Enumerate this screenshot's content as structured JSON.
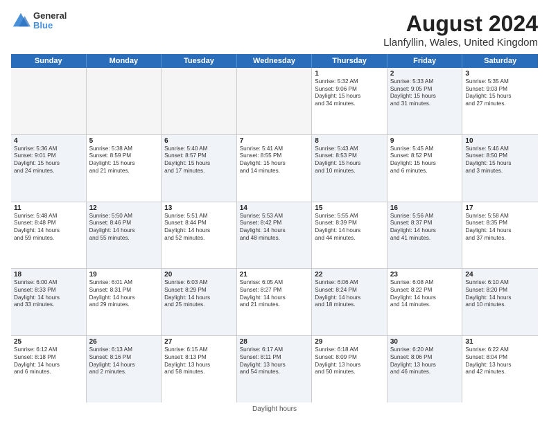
{
  "header": {
    "logo_line1": "General",
    "logo_line2": "Blue",
    "main_title": "August 2024",
    "subtitle": "Llanfyllin, Wales, United Kingdom"
  },
  "weekdays": [
    "Sunday",
    "Monday",
    "Tuesday",
    "Wednesday",
    "Thursday",
    "Friday",
    "Saturday"
  ],
  "footer": "Daylight hours",
  "rows": [
    [
      {
        "num": "",
        "lines": [],
        "shaded": false,
        "empty": true
      },
      {
        "num": "",
        "lines": [],
        "shaded": false,
        "empty": true
      },
      {
        "num": "",
        "lines": [],
        "shaded": false,
        "empty": true
      },
      {
        "num": "",
        "lines": [],
        "shaded": false,
        "empty": true
      },
      {
        "num": "1",
        "lines": [
          "Sunrise: 5:32 AM",
          "Sunset: 9:06 PM",
          "Daylight: 15 hours",
          "and 34 minutes."
        ],
        "shaded": false,
        "empty": false
      },
      {
        "num": "2",
        "lines": [
          "Sunrise: 5:33 AM",
          "Sunset: 9:05 PM",
          "Daylight: 15 hours",
          "and 31 minutes."
        ],
        "shaded": true,
        "empty": false
      },
      {
        "num": "3",
        "lines": [
          "Sunrise: 5:35 AM",
          "Sunset: 9:03 PM",
          "Daylight: 15 hours",
          "and 27 minutes."
        ],
        "shaded": false,
        "empty": false
      }
    ],
    [
      {
        "num": "4",
        "lines": [
          "Sunrise: 5:36 AM",
          "Sunset: 9:01 PM",
          "Daylight: 15 hours",
          "and 24 minutes."
        ],
        "shaded": true,
        "empty": false
      },
      {
        "num": "5",
        "lines": [
          "Sunrise: 5:38 AM",
          "Sunset: 8:59 PM",
          "Daylight: 15 hours",
          "and 21 minutes."
        ],
        "shaded": false,
        "empty": false
      },
      {
        "num": "6",
        "lines": [
          "Sunrise: 5:40 AM",
          "Sunset: 8:57 PM",
          "Daylight: 15 hours",
          "and 17 minutes."
        ],
        "shaded": true,
        "empty": false
      },
      {
        "num": "7",
        "lines": [
          "Sunrise: 5:41 AM",
          "Sunset: 8:55 PM",
          "Daylight: 15 hours",
          "and 14 minutes."
        ],
        "shaded": false,
        "empty": false
      },
      {
        "num": "8",
        "lines": [
          "Sunrise: 5:43 AM",
          "Sunset: 8:53 PM",
          "Daylight: 15 hours",
          "and 10 minutes."
        ],
        "shaded": true,
        "empty": false
      },
      {
        "num": "9",
        "lines": [
          "Sunrise: 5:45 AM",
          "Sunset: 8:52 PM",
          "Daylight: 15 hours",
          "and 6 minutes."
        ],
        "shaded": false,
        "empty": false
      },
      {
        "num": "10",
        "lines": [
          "Sunrise: 5:46 AM",
          "Sunset: 8:50 PM",
          "Daylight: 15 hours",
          "and 3 minutes."
        ],
        "shaded": true,
        "empty": false
      }
    ],
    [
      {
        "num": "11",
        "lines": [
          "Sunrise: 5:48 AM",
          "Sunset: 8:48 PM",
          "Daylight: 14 hours",
          "and 59 minutes."
        ],
        "shaded": false,
        "empty": false
      },
      {
        "num": "12",
        "lines": [
          "Sunrise: 5:50 AM",
          "Sunset: 8:46 PM",
          "Daylight: 14 hours",
          "and 55 minutes."
        ],
        "shaded": true,
        "empty": false
      },
      {
        "num": "13",
        "lines": [
          "Sunrise: 5:51 AM",
          "Sunset: 8:44 PM",
          "Daylight: 14 hours",
          "and 52 minutes."
        ],
        "shaded": false,
        "empty": false
      },
      {
        "num": "14",
        "lines": [
          "Sunrise: 5:53 AM",
          "Sunset: 8:42 PM",
          "Daylight: 14 hours",
          "and 48 minutes."
        ],
        "shaded": true,
        "empty": false
      },
      {
        "num": "15",
        "lines": [
          "Sunrise: 5:55 AM",
          "Sunset: 8:39 PM",
          "Daylight: 14 hours",
          "and 44 minutes."
        ],
        "shaded": false,
        "empty": false
      },
      {
        "num": "16",
        "lines": [
          "Sunrise: 5:56 AM",
          "Sunset: 8:37 PM",
          "Daylight: 14 hours",
          "and 41 minutes."
        ],
        "shaded": true,
        "empty": false
      },
      {
        "num": "17",
        "lines": [
          "Sunrise: 5:58 AM",
          "Sunset: 8:35 PM",
          "Daylight: 14 hours",
          "and 37 minutes."
        ],
        "shaded": false,
        "empty": false
      }
    ],
    [
      {
        "num": "18",
        "lines": [
          "Sunrise: 6:00 AM",
          "Sunset: 8:33 PM",
          "Daylight: 14 hours",
          "and 33 minutes."
        ],
        "shaded": true,
        "empty": false
      },
      {
        "num": "19",
        "lines": [
          "Sunrise: 6:01 AM",
          "Sunset: 8:31 PM",
          "Daylight: 14 hours",
          "and 29 minutes."
        ],
        "shaded": false,
        "empty": false
      },
      {
        "num": "20",
        "lines": [
          "Sunrise: 6:03 AM",
          "Sunset: 8:29 PM",
          "Daylight: 14 hours",
          "and 25 minutes."
        ],
        "shaded": true,
        "empty": false
      },
      {
        "num": "21",
        "lines": [
          "Sunrise: 6:05 AM",
          "Sunset: 8:27 PM",
          "Daylight: 14 hours",
          "and 21 minutes."
        ],
        "shaded": false,
        "empty": false
      },
      {
        "num": "22",
        "lines": [
          "Sunrise: 6:06 AM",
          "Sunset: 8:24 PM",
          "Daylight: 14 hours",
          "and 18 minutes."
        ],
        "shaded": true,
        "empty": false
      },
      {
        "num": "23",
        "lines": [
          "Sunrise: 6:08 AM",
          "Sunset: 8:22 PM",
          "Daylight: 14 hours",
          "and 14 minutes."
        ],
        "shaded": false,
        "empty": false
      },
      {
        "num": "24",
        "lines": [
          "Sunrise: 6:10 AM",
          "Sunset: 8:20 PM",
          "Daylight: 14 hours",
          "and 10 minutes."
        ],
        "shaded": true,
        "empty": false
      }
    ],
    [
      {
        "num": "25",
        "lines": [
          "Sunrise: 6:12 AM",
          "Sunset: 8:18 PM",
          "Daylight: 14 hours",
          "and 6 minutes."
        ],
        "shaded": false,
        "empty": false
      },
      {
        "num": "26",
        "lines": [
          "Sunrise: 6:13 AM",
          "Sunset: 8:16 PM",
          "Daylight: 14 hours",
          "and 2 minutes."
        ],
        "shaded": true,
        "empty": false
      },
      {
        "num": "27",
        "lines": [
          "Sunrise: 6:15 AM",
          "Sunset: 8:13 PM",
          "Daylight: 13 hours",
          "and 58 minutes."
        ],
        "shaded": false,
        "empty": false
      },
      {
        "num": "28",
        "lines": [
          "Sunrise: 6:17 AM",
          "Sunset: 8:11 PM",
          "Daylight: 13 hours",
          "and 54 minutes."
        ],
        "shaded": true,
        "empty": false
      },
      {
        "num": "29",
        "lines": [
          "Sunrise: 6:18 AM",
          "Sunset: 8:09 PM",
          "Daylight: 13 hours",
          "and 50 minutes."
        ],
        "shaded": false,
        "empty": false
      },
      {
        "num": "30",
        "lines": [
          "Sunrise: 6:20 AM",
          "Sunset: 8:06 PM",
          "Daylight: 13 hours",
          "and 46 minutes."
        ],
        "shaded": true,
        "empty": false
      },
      {
        "num": "31",
        "lines": [
          "Sunrise: 6:22 AM",
          "Sunset: 8:04 PM",
          "Daylight: 13 hours",
          "and 42 minutes."
        ],
        "shaded": false,
        "empty": false
      }
    ]
  ]
}
